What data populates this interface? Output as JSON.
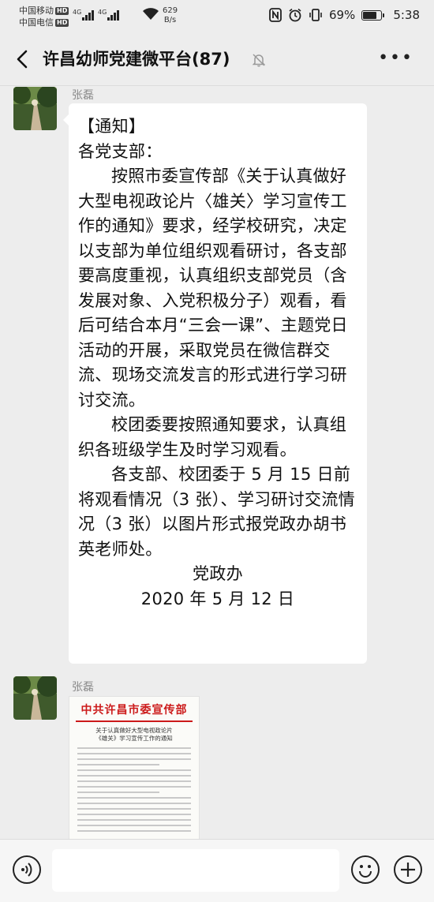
{
  "status_bar": {
    "carrier1": "中国移动",
    "carrier2": "中国电信",
    "hd": "HD",
    "net_speed_value": "629",
    "net_speed_unit": "B/s",
    "battery": "69%",
    "time": "5:38",
    "network1": "4G",
    "network2": "4G"
  },
  "header": {
    "title": "许昌幼师党建微平台(87)"
  },
  "messages": [
    {
      "sender": "张磊",
      "type": "text",
      "heading": "【通知】",
      "salutation": "各党支部：",
      "para1": "按照市委宣传部《关于认真做好大型电视政论片〈雄关〉学习宣传工作的通知》要求，经学校研究，决定以支部为单位组织观看研讨，各支部要高度重视，认真组织支部党员（含发展对象、入党积极分子）观看，看后可结合本月“三会一课”、主题党日活动的开展，采取党员在微信群交流、现场交流发言的形式进行学习研讨交流。",
      "para2": "校团委要按照通知要求，认真组织各班级学生及时学习观看。",
      "para3": "各支部、校团委于 5 月 15 日前将观看情况（3 张）、学习研讨交流情况（3 张）以图片形式报党政办胡书英老师处。",
      "signature": "党政办",
      "date": "2020 年 5 月 12 日"
    },
    {
      "sender": "张磊",
      "type": "image",
      "doc_header": "中共许昌市委宣传部",
      "doc_subtitle_1": "关于认真做好大型电视政论片",
      "doc_subtitle_2": "《雄关》学习宣传工作的通知"
    }
  ],
  "icons": {
    "back": "chevron-left-icon",
    "mute": "bell-off-icon",
    "more": "more-dots-icon",
    "voice": "voice-icon",
    "emoji": "emoji-icon",
    "plus": "plus-icon"
  }
}
